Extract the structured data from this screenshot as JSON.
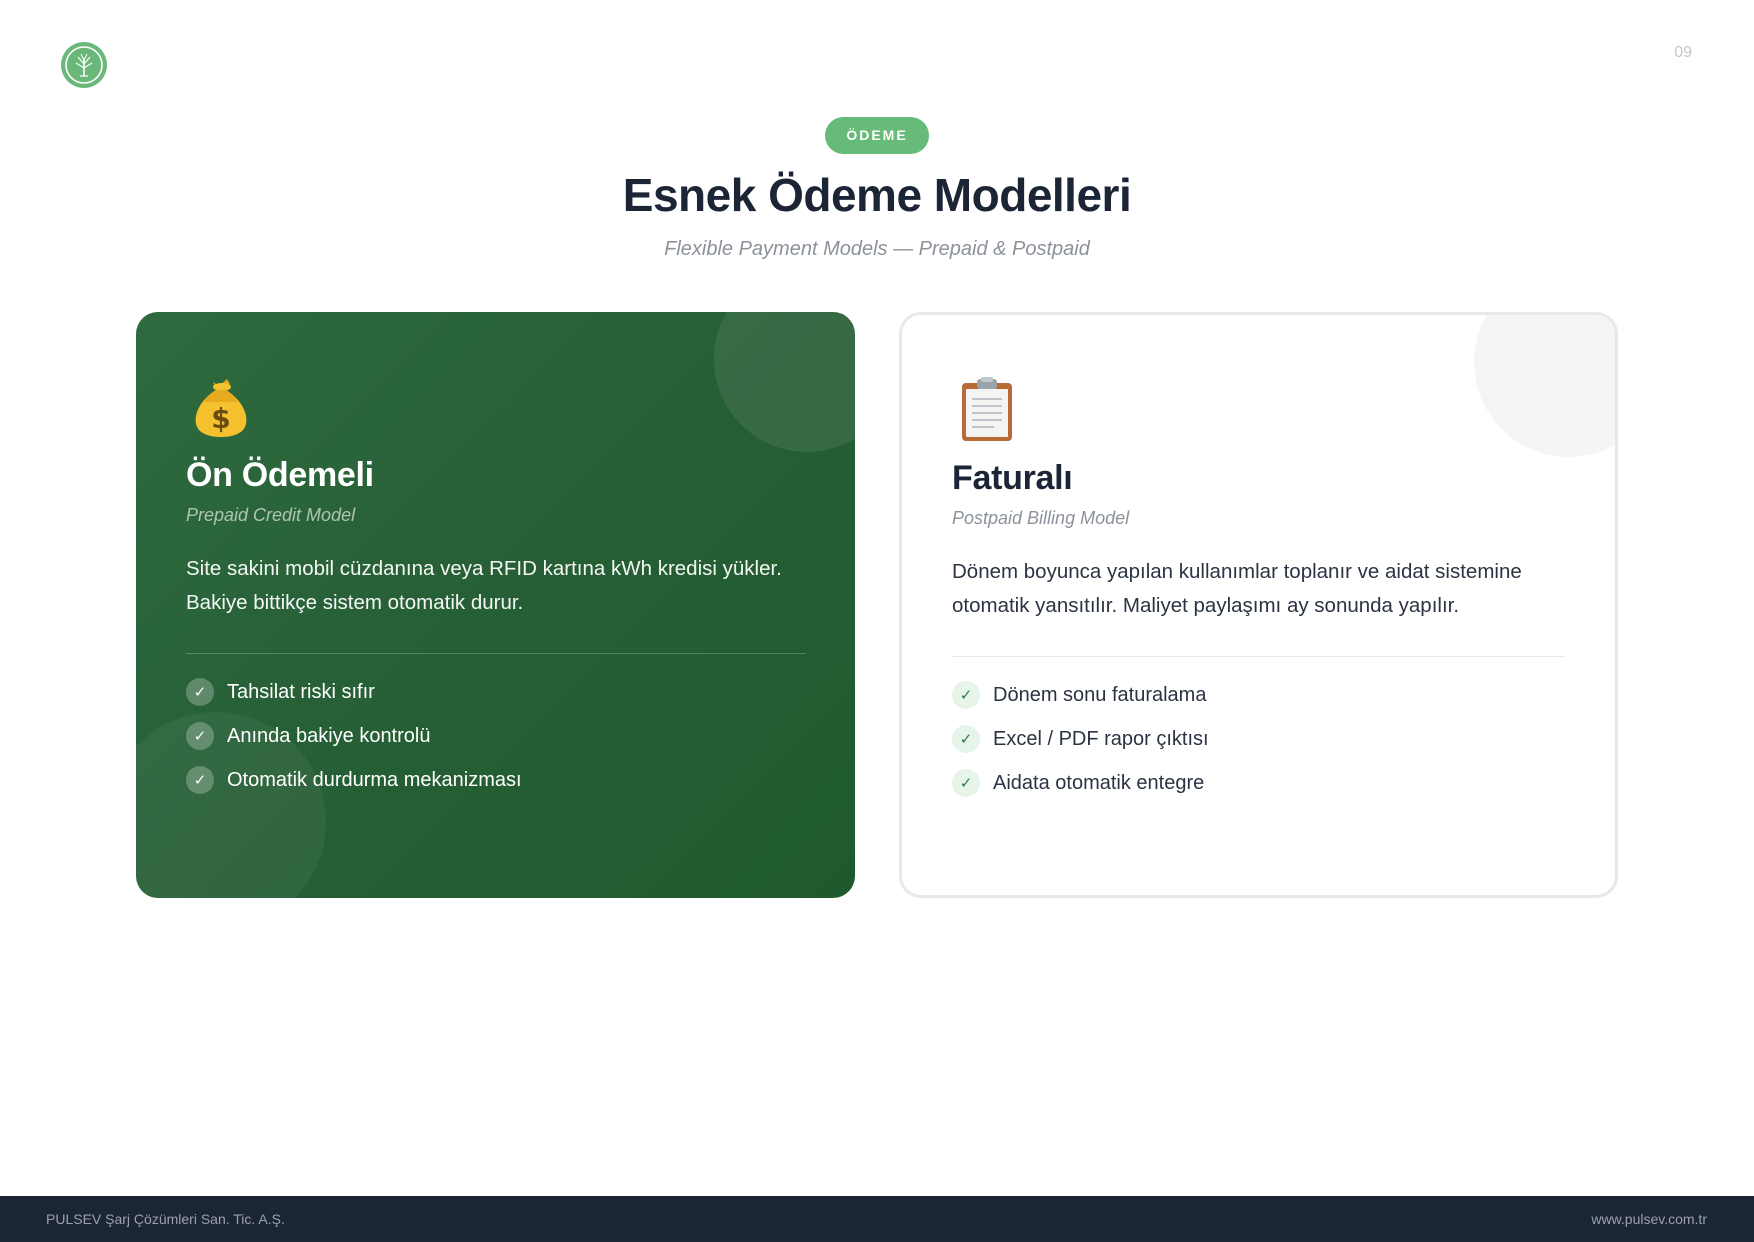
{
  "page": {
    "number": "09"
  },
  "header": {
    "badge": "ÖDEME",
    "title": "Esnek Ödeme Modelleri",
    "subtitle": "Flexible Payment Models — Prepaid & Postpaid"
  },
  "cards": [
    {
      "icon": "money-bag-icon",
      "title": "Ön Ödemeli",
      "subtitle": "Prepaid Credit Model",
      "description": "Site sakini mobil cüzdanına veya RFID kartına kWh kredisi yükler. Bakiye bittikçe sistem otomatik durur.",
      "features": [
        "Tahsilat riski sıfır",
        "Anında bakiye kontrolü",
        "Otomatik durdurma mekanizması"
      ]
    },
    {
      "icon": "clipboard-icon",
      "title": "Faturalı",
      "subtitle": "Postpaid Billing Model",
      "description": "Dönem boyunca yapılan kullanımlar toplanır ve aidat sistemine otomatik yansıtılır. Maliyet paylaşımı ay sonunda yapılır.",
      "features": [
        "Dönem sonu faturalama",
        "Excel / PDF rapor çıktısı",
        "Aidata otomatik entegre"
      ]
    }
  ],
  "footer": {
    "company": "PULSEV Şarj Çözümleri San. Tic. A.Ş.",
    "website": "www.pulsev.com.tr"
  },
  "colors": {
    "brand_green": "#66bb78",
    "dark_green": "#275f36",
    "navy": "#1b2535"
  },
  "icons": {
    "logo": "tree-logo-icon",
    "check": "check-icon"
  }
}
